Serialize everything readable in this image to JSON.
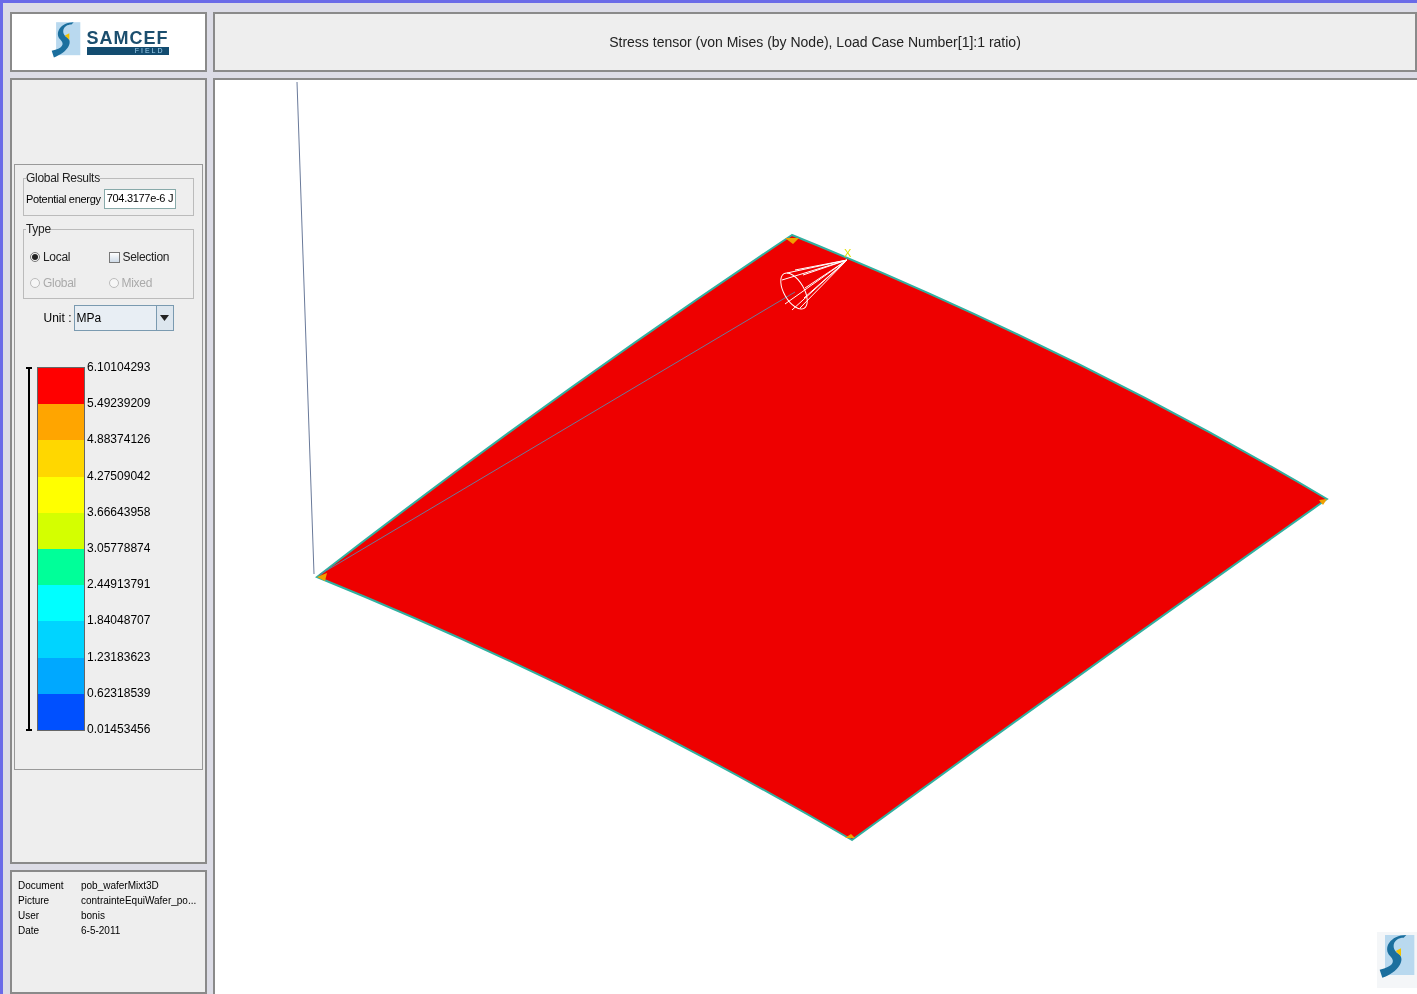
{
  "title": "Stress tensor (von Mises (by Node), Load Case Number[1]:1 ratio)",
  "global_results": {
    "title": "Global Results",
    "label": "Potential energy",
    "value": "704.3177e-6 J"
  },
  "type": {
    "title": "Type",
    "options": [
      {
        "kind": "radio",
        "label": "Local",
        "selected": true,
        "disabled": false
      },
      {
        "kind": "checkbox",
        "label": "Selection",
        "checked": false
      },
      {
        "kind": "radio",
        "label": "Global",
        "selected": false,
        "disabled": true
      },
      {
        "kind": "radio",
        "label": "Mixed",
        "selected": false,
        "disabled": true
      }
    ]
  },
  "unit": {
    "label": "Unit :",
    "value": "MPa"
  },
  "legend": {
    "labels": [
      "6.10104293",
      "5.49239209",
      "4.88374126",
      "4.27509042",
      "3.66643958",
      "3.05778874",
      "2.44913791",
      "1.84048707",
      "1.23183623",
      "0.62318539",
      "0.01453456"
    ],
    "bands": [
      {
        "color": "#ff0000"
      },
      {
        "color": "#ffa500"
      },
      {
        "color": "#ffd700"
      },
      {
        "color": "#ffff00"
      },
      {
        "color": "#d4ff00"
      },
      {
        "color": "#00ff99"
      },
      {
        "color": "#00ffff"
      },
      {
        "color": "#00d4ff"
      },
      {
        "color": "#00a8ff"
      },
      {
        "color": "#0050ff"
      }
    ]
  },
  "info": [
    {
      "key": "Document",
      "value": "pob_waferMixt3D"
    },
    {
      "key": "Picture",
      "value": "contrainteEquiWafer_po..."
    },
    {
      "key": "User",
      "value": "bonis"
    },
    {
      "key": "Date",
      "value": "6-5-2011"
    }
  ],
  "viewport": {
    "axis_label": "X"
  },
  "logo": {
    "name": "SAMCEF",
    "sub": "FIELD"
  }
}
